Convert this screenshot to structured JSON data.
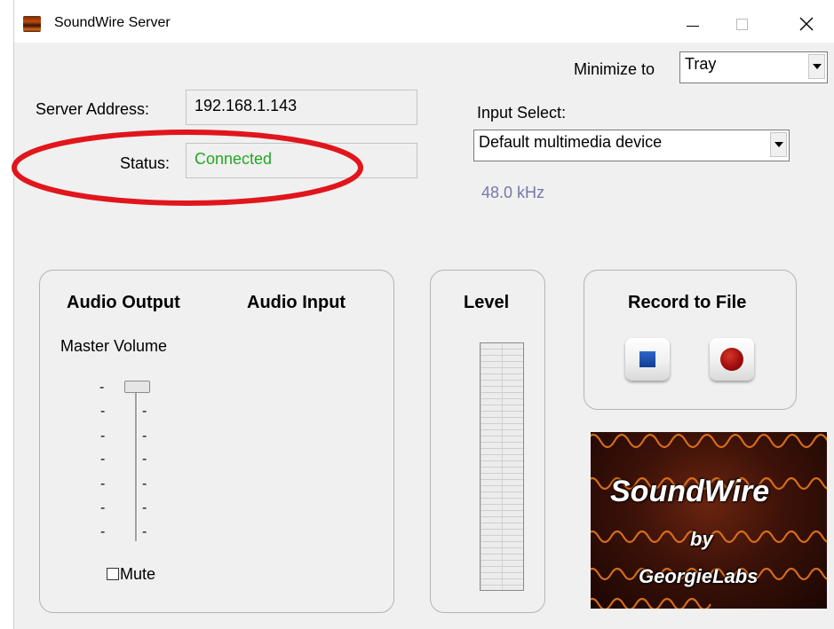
{
  "window": {
    "title": "SoundWire Server",
    "controls": {
      "minimize": "minimize-icon",
      "maximize": "maximize-icon",
      "close": "close-icon"
    }
  },
  "minimize_to": {
    "label": "Minimize to",
    "value": "Tray"
  },
  "server": {
    "address_label": "Server Address:",
    "address_value": "192.168.1.143",
    "status_label": "Status:",
    "status_value": "Connected",
    "status_color": "#22a822"
  },
  "input": {
    "label": "Input Select:",
    "device": "Default multimedia device",
    "sample_rate": "48.0 kHz",
    "sample_rate_color": "#7777aa"
  },
  "audio": {
    "output_label": "Audio Output",
    "input_label": "Audio Input",
    "master_volume_label": "Master Volume",
    "mute_label": "Mute",
    "mute_checked": false,
    "volume_level": 1.0
  },
  "level": {
    "label": "Level"
  },
  "record": {
    "label": "Record to File",
    "stop_icon": "stop-icon",
    "record_icon": "record-icon"
  },
  "logo": {
    "name": "SoundWire",
    "by": "by",
    "company": "GeorgieLabs"
  },
  "annotation": {
    "color": "#e0161c",
    "shape": "ellipse"
  }
}
